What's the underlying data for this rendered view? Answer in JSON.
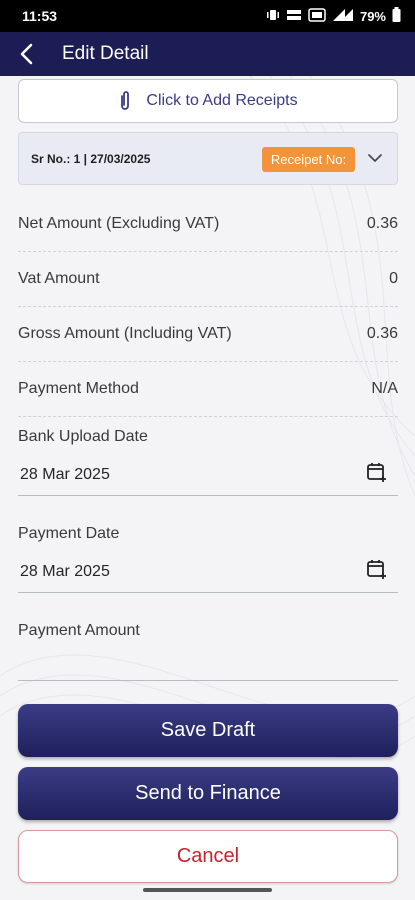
{
  "status_bar": {
    "time": "11:53",
    "battery": "79%"
  },
  "app_bar": {
    "title": "Edit Detail"
  },
  "receipts": {
    "add_label": "Click to Add Receipts"
  },
  "sr_card": {
    "sr_text": "Sr No.: 1 | 27/03/2025",
    "badge": "Receipet No:"
  },
  "summary": [
    {
      "label": "Net Amount (Excluding VAT)",
      "value": "0.36"
    },
    {
      "label": "Vat Amount",
      "value": "0"
    },
    {
      "label": "Gross Amount (Including VAT)",
      "value": "0.36"
    },
    {
      "label": "Payment Method",
      "value": "N/A"
    }
  ],
  "bank_upload": {
    "label": "Bank Upload Date",
    "value": "28 Mar 2025"
  },
  "payment_date": {
    "label": "Payment Date",
    "value": "28 Mar 2025"
  },
  "payment_amount": {
    "label": "Payment Amount",
    "value": ""
  },
  "buttons": {
    "save_draft": "Save Draft",
    "send_finance": "Send to Finance",
    "cancel": "Cancel"
  },
  "colors": {
    "app_bar": "#1c1d54",
    "primary": "#2d2e72",
    "badge": "#f2953a",
    "cancel": "#c8232b"
  }
}
